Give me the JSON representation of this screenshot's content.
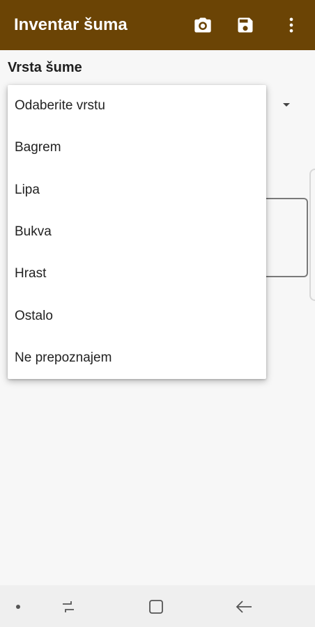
{
  "app": {
    "title": "Inventar šuma",
    "bar_color": "#6b4405",
    "actions": [
      {
        "name": "camera-icon"
      },
      {
        "name": "save-icon"
      },
      {
        "name": "more-vert-icon"
      }
    ]
  },
  "form": {
    "section_label": "Vrsta šume"
  },
  "dropdown": {
    "options": [
      "Odaberite vrstu",
      "Bagrem",
      "Lipa",
      "Bukva",
      "Hrast",
      "Ostalo",
      "Ne prepoznajem"
    ]
  },
  "navigation": {
    "icons": [
      "dot-icon",
      "recent-apps-icon",
      "home-icon",
      "back-icon"
    ]
  }
}
